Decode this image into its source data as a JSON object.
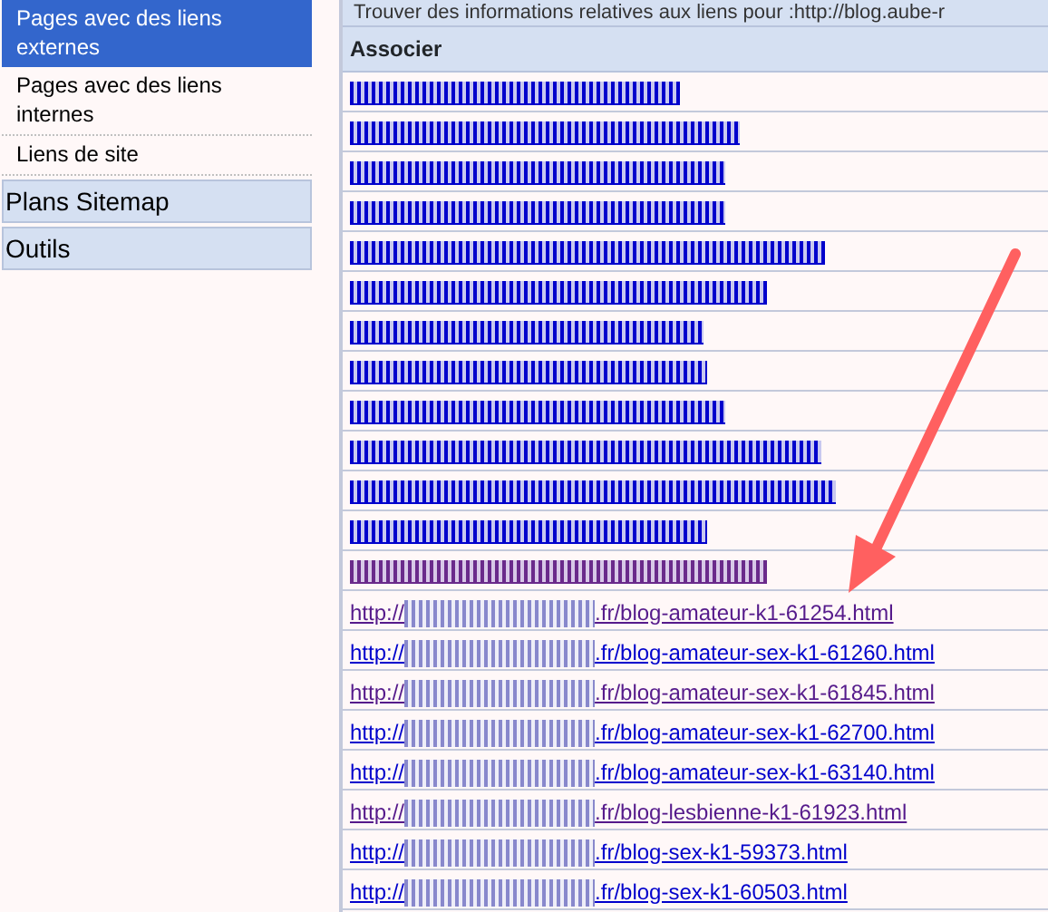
{
  "sidebar": {
    "items": [
      {
        "label": "Pages avec des liens externes",
        "selected": true
      },
      {
        "label": "Pages avec des liens internes",
        "selected": false
      },
      {
        "label": "Liens de site",
        "selected": false
      }
    ],
    "sections": [
      {
        "label": "Plans Sitemap"
      },
      {
        "label": "Outils"
      }
    ]
  },
  "main": {
    "title": "Trouver des informations relatives aux liens pour :http://blog.aube-r",
    "table": {
      "columns": [
        "Associer"
      ],
      "rows": [
        {
          "kind": "redacted",
          "visited": false
        },
        {
          "kind": "redacted",
          "visited": false
        },
        {
          "kind": "redacted",
          "visited": false
        },
        {
          "kind": "redacted",
          "visited": false
        },
        {
          "kind": "redacted",
          "visited": false
        },
        {
          "kind": "redacted",
          "visited": false
        },
        {
          "kind": "redacted",
          "visited": false
        },
        {
          "kind": "redacted",
          "visited": false
        },
        {
          "kind": "redacted",
          "visited": false
        },
        {
          "kind": "redacted",
          "visited": false
        },
        {
          "kind": "redacted",
          "visited": false
        },
        {
          "kind": "redacted",
          "visited": false
        },
        {
          "kind": "redacted",
          "visited": true
        },
        {
          "kind": "link",
          "prefix": "http://",
          "suffix": ".fr/blog-amateur-k1-61254.html",
          "visited": true
        },
        {
          "kind": "link",
          "prefix": "http://",
          "suffix": ".fr/blog-amateur-sex-k1-61260.html",
          "visited": false
        },
        {
          "kind": "link",
          "prefix": "http://",
          "suffix": ".fr/blog-amateur-sex-k1-61845.html",
          "visited": true
        },
        {
          "kind": "link",
          "prefix": "http://",
          "suffix": ".fr/blog-amateur-sex-k1-62700.html",
          "visited": false
        },
        {
          "kind": "link",
          "prefix": "http://",
          "suffix": ".fr/blog-amateur-sex-k1-63140.html",
          "visited": false
        },
        {
          "kind": "link",
          "prefix": "http://",
          "suffix": ".fr/blog-lesbienne-k1-61923.html",
          "visited": true
        },
        {
          "kind": "link",
          "prefix": "http://",
          "suffix": ".fr/blog-sex-k1-59373.html",
          "visited": false
        },
        {
          "kind": "link",
          "prefix": "http://",
          "suffix": ".fr/blog-sex-k1-60503.html",
          "visited": false
        }
      ]
    }
  }
}
